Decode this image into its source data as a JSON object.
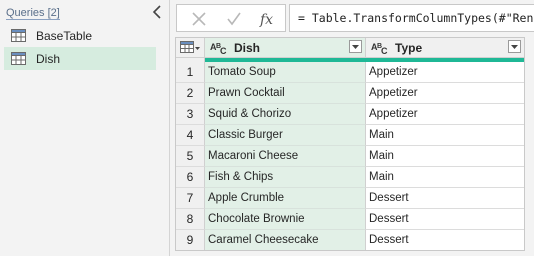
{
  "queries": {
    "header": "Queries [2]",
    "items": [
      {
        "label": "BaseTable",
        "selected": false
      },
      {
        "label": "Dish",
        "selected": true
      }
    ]
  },
  "formula_bar": {
    "formula": "= Table.TransformColumnTypes(#\"Renamed Columns\",{{\"Dish\", type text}, {\"Type\", type text}})"
  },
  "grid": {
    "columns": [
      {
        "label": "Dish",
        "type_icon": "ABC-text-type-icon",
        "selected": true
      },
      {
        "label": "Type",
        "type_icon": "ABC-text-type-icon",
        "selected": false
      }
    ],
    "rows": [
      {
        "num": "1",
        "dish": "Tomato Soup",
        "type": "Appetizer"
      },
      {
        "num": "2",
        "dish": "Prawn Cocktail",
        "type": "Appetizer"
      },
      {
        "num": "3",
        "dish": "Squid & Chorizo",
        "type": "Appetizer"
      },
      {
        "num": "4",
        "dish": "Classic Burger",
        "type": "Main"
      },
      {
        "num": "5",
        "dish": "Macaroni Cheese",
        "type": "Main"
      },
      {
        "num": "6",
        "dish": "Fish & Chips",
        "type": "Main"
      },
      {
        "num": "7",
        "dish": "Apple Crumble",
        "type": "Dessert"
      },
      {
        "num": "8",
        "dish": "Chocolate Brownie",
        "type": "Dessert"
      },
      {
        "num": "9",
        "dish": "Caramel Cheesecake",
        "type": "Dessert"
      }
    ]
  },
  "colors": {
    "selected_column_bg": "#e2f0e7",
    "selected_query_bg": "#d6ecdf",
    "quality_bar": "#1fb896"
  }
}
